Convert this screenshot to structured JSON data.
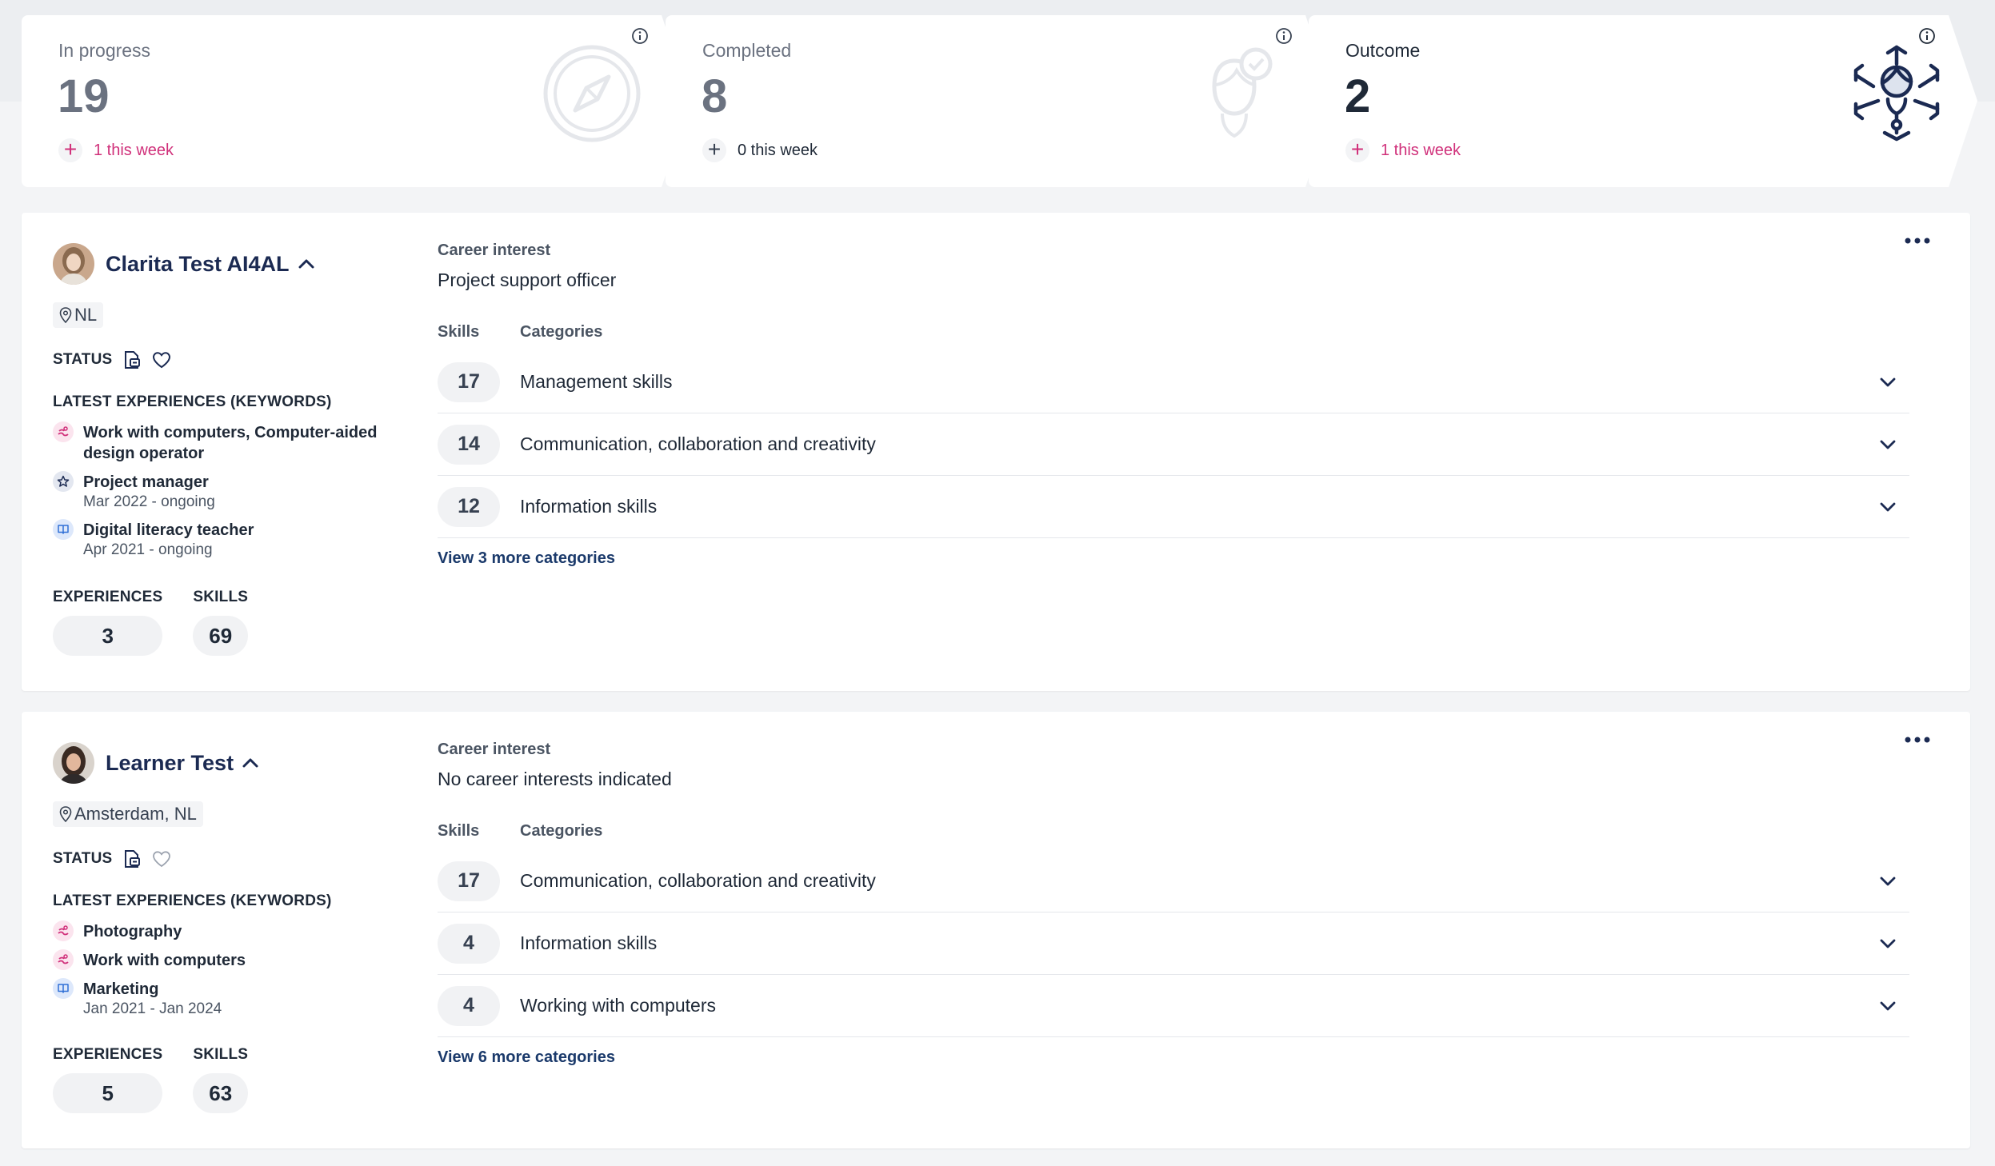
{
  "stats": [
    {
      "label": "In progress",
      "value": "19",
      "delta": "1 this week",
      "icon": "compass-icon"
    },
    {
      "label": "Completed",
      "value": "8",
      "delta": "0 this week",
      "icon": "person-check-icon"
    },
    {
      "label": "Outcome",
      "value": "2",
      "delta": "1 this week",
      "icon": "person-network-icon"
    }
  ],
  "colors": {
    "accent_pink": "#d0307a",
    "navy": "#1b2a52",
    "link": "#1b3a6b"
  },
  "learners": [
    {
      "name": "Clarita Test AI4AL",
      "location": "NL",
      "status_label": "STATUS",
      "status_favorite": true,
      "latest_label": "LATEST EXPERIENCES (KEYWORDS)",
      "experiences": [
        {
          "title": "Work with computers, Computer-aided design operator",
          "date": "",
          "icon": "skill-icon"
        },
        {
          "title": "Project manager",
          "date": "Mar 2022 - ongoing",
          "icon": "star-icon"
        },
        {
          "title": "Digital literacy teacher",
          "date": "Apr 2021 - ongoing",
          "icon": "book-icon"
        }
      ],
      "experiences_label": "EXPERIENCES",
      "experiences_count": "3",
      "skills_label": "SKILLS",
      "skills_count": "69",
      "career_label": "Career interest",
      "career_value": "Project support officer",
      "skills_head": "Skills",
      "categories_head": "Categories",
      "categories": [
        {
          "count": "17",
          "name": "Management skills"
        },
        {
          "count": "14",
          "name": "Communication, collaboration and creativity"
        },
        {
          "count": "12",
          "name": "Information skills"
        }
      ],
      "view_more": "View 3 more categories"
    },
    {
      "name": "Learner Test",
      "location": "Amsterdam, NL",
      "status_label": "STATUS",
      "status_favorite": false,
      "latest_label": "LATEST EXPERIENCES (KEYWORDS)",
      "experiences": [
        {
          "title": "Photography",
          "date": "",
          "icon": "skill-icon"
        },
        {
          "title": "Work with computers",
          "date": "",
          "icon": "skill-icon"
        },
        {
          "title": "Marketing",
          "date": "Jan 2021 - Jan 2024",
          "icon": "book-icon"
        }
      ],
      "experiences_label": "EXPERIENCES",
      "experiences_count": "5",
      "skills_label": "SKILLS",
      "skills_count": "63",
      "career_label": "Career interest",
      "career_value": "No career interests indicated",
      "skills_head": "Skills",
      "categories_head": "Categories",
      "categories": [
        {
          "count": "17",
          "name": "Communication, collaboration and creativity"
        },
        {
          "count": "4",
          "name": "Information skills"
        },
        {
          "count": "4",
          "name": "Working with computers"
        }
      ],
      "view_more": "View 6 more categories"
    }
  ]
}
